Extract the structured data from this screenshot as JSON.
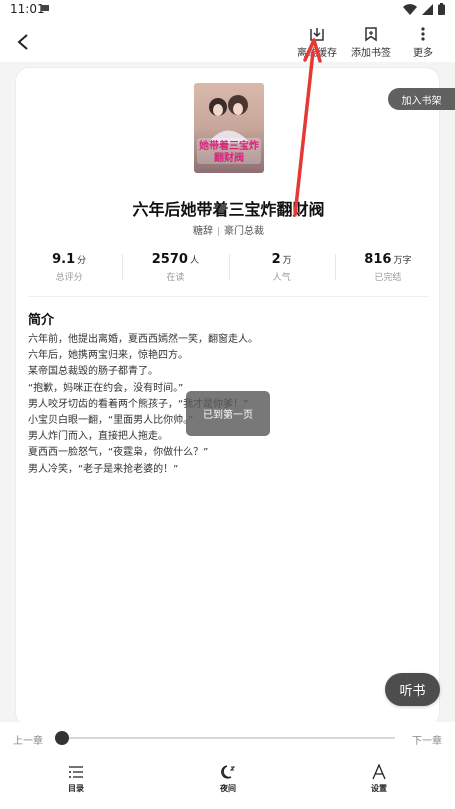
{
  "status_bar": {
    "time": "11:01"
  },
  "top_bar": {
    "offline_cache_label": "离线缓存",
    "bookmark_label": "添加书签",
    "more_label": "更多"
  },
  "add_to_shelf": "加入书架",
  "book": {
    "title": "六年后她带着三宝炸翻财阀",
    "author": "糖辞",
    "category": "豪门总裁",
    "cover_title_text": "她带着三宝炸翻财阀"
  },
  "stats": [
    {
      "value": "9.1",
      "unit": "分",
      "label": "总评分"
    },
    {
      "value": "2570",
      "unit": "人",
      "label": "在读"
    },
    {
      "value": "2",
      "unit": "万",
      "label": "人气"
    },
    {
      "value": "816",
      "unit": "万字",
      "label": "已完结"
    }
  ],
  "intro": {
    "heading": "简介",
    "lines": [
      "六年前，他提出离婚，夏西西嫣然一笑，翻窗走人。",
      "六年后，她携两宝归来，惊艳四方。",
      "某帝国总裁毁的肠子都青了。",
      "“抱歉，妈咪正在约会，没有时间。”",
      "男人咬牙切齿的看着两个熊孩子，“我才是你爹！”",
      "小宝贝白眼一翻，“里面男人比你帅。”",
      "男人炸门而入，直接把人拖走。",
      "夏西西一脸怒气，“夜霆枭，你做什么？”",
      "男人冷笑，“老子是来抢老婆的！”"
    ]
  },
  "toast": "已到第一页",
  "listen_button": "听书",
  "bottom": {
    "prev_chapter": "上一章",
    "next_chapter": "下一章",
    "progress": 0,
    "catalog_label": "目录",
    "night_label": "夜间",
    "settings_label": "设置"
  },
  "colors": {
    "annotation_arrow": "#e53935",
    "dark_button": "#4d4d4d"
  }
}
